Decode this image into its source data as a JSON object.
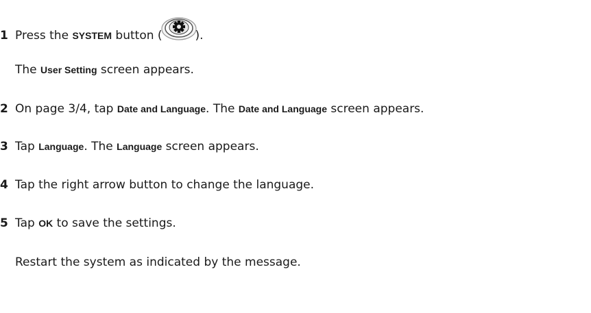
{
  "steps": [
    {
      "number": "1",
      "text_before": "Press the ",
      "ui_label": "SYSTEM",
      "text_after": " button (",
      "text_end": ").",
      "icon": "gear-icon",
      "note": "The ",
      "note_ui": "User Setting",
      "note_after": " screen appears."
    },
    {
      "number": "2",
      "text_before": "On page 3/4, tap ",
      "ui_label": "Date and Language",
      "text_mid": ". The ",
      "ui_label2": "Date and Language",
      "text_after": " screen appears."
    },
    {
      "number": "3",
      "text_before": "Tap ",
      "ui_label": "Language",
      "text_mid": ". The ",
      "ui_label2": "Language",
      "text_after": " screen appears."
    },
    {
      "number": "4",
      "text": "Tap the right arrow button to change the language."
    },
    {
      "number": "5",
      "text_before": "Tap ",
      "ui_label": "OK",
      "text_after": " to save the settings.",
      "note": "Restart the system as indicated by the message."
    }
  ]
}
